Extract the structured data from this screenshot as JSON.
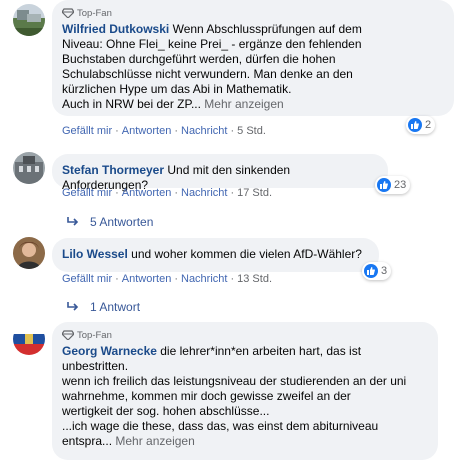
{
  "colors": {
    "bubble_bg": "#f0f2f5",
    "like_blue": "#1877f2",
    "link": "#385898",
    "meta": "#65676b"
  },
  "comments": [
    {
      "badge": "Top-Fan",
      "author": "Wilfried Dutkowski",
      "text": " Wenn Abschlussprüfungen auf dem\nNiveau: Ohne Flei_ keine Prei_ - ergänze den fehlenden\nBuchstaben durchgeführt werden, dürfen die hohen\nSchulabschlüsse nicht verwundern. Man denke an den\nkürzlichen Hype um das Abi in Mathematik.\nAuch in NRW bei der ZP",
      "ellipsis": "...",
      "more": " Mehr anzeigen",
      "actions": {
        "like": "Gefällt mir",
        "reply": "Antworten",
        "message": "Nachricht",
        "time": "5 Std."
      },
      "reactions": "2",
      "avatar_icon": "landscape-avatar"
    },
    {
      "author": "Stefan Thormeyer",
      "text": " Und mit den sinkenden Anforderungen?",
      "actions": {
        "like": "Gefällt mir",
        "reply": "Antworten",
        "message": "Nachricht",
        "time": "17 Std."
      },
      "reactions": "23",
      "replies": "5 Antworten",
      "avatar_icon": "building-avatar"
    },
    {
      "author": "Lilo Wessel",
      "text": " und woher kommen die vielen AfD-Wähler?",
      "actions": {
        "like": "Gefällt mir",
        "reply": "Antworten",
        "message": "Nachricht",
        "time": "13 Std."
      },
      "reactions": "3",
      "replies": "1 Antwort",
      "avatar_icon": "person-avatar"
    },
    {
      "badge": "Top-Fan",
      "author": "Georg Warnecke",
      "text": " die lehrer*inn*en arbeiten hart, das ist\nunbestritten.\nwenn ich freilich das leistungsniveau der studierenden an der uni\nwahrnehme, kommen mir doch gewisse zweifel an der\nwertigkeit der sog. hohen abschlüsse...\n...ich wage die these, dass das, was einst dem abiturniveau\nentspra",
      "ellipsis": "...",
      "more": " Mehr anzeigen",
      "avatar_icon": "flag-avatar"
    }
  ]
}
